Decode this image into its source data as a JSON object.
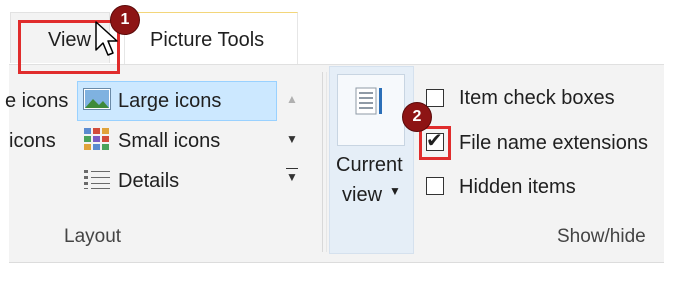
{
  "tabs": {
    "view": "View",
    "picture_tools": "Picture Tools"
  },
  "layout": {
    "extra_large_icons_partial": "e icons",
    "medium_icons_partial": "icons",
    "large_icons": "Large icons",
    "small_icons": "Small icons",
    "details": "Details",
    "group_label": "Layout"
  },
  "current_view": {
    "line1": "Current",
    "line2": "view"
  },
  "show_hide": {
    "item_check_boxes": "Item check boxes",
    "item_check_boxes_checked": false,
    "file_name_extensions": "File name extensions",
    "file_name_extensions_checked": true,
    "hidden_items": "Hidden items",
    "hidden_items_checked": false,
    "group_label": "Show/hide"
  },
  "annotations": {
    "step1": "1",
    "step2": "2",
    "highlight_color": "#e02c2c",
    "badge_color": "#8d1414"
  },
  "colors": {
    "selection_bg": "#cce8ff",
    "ribbon_bg": "#f3f3f3"
  }
}
